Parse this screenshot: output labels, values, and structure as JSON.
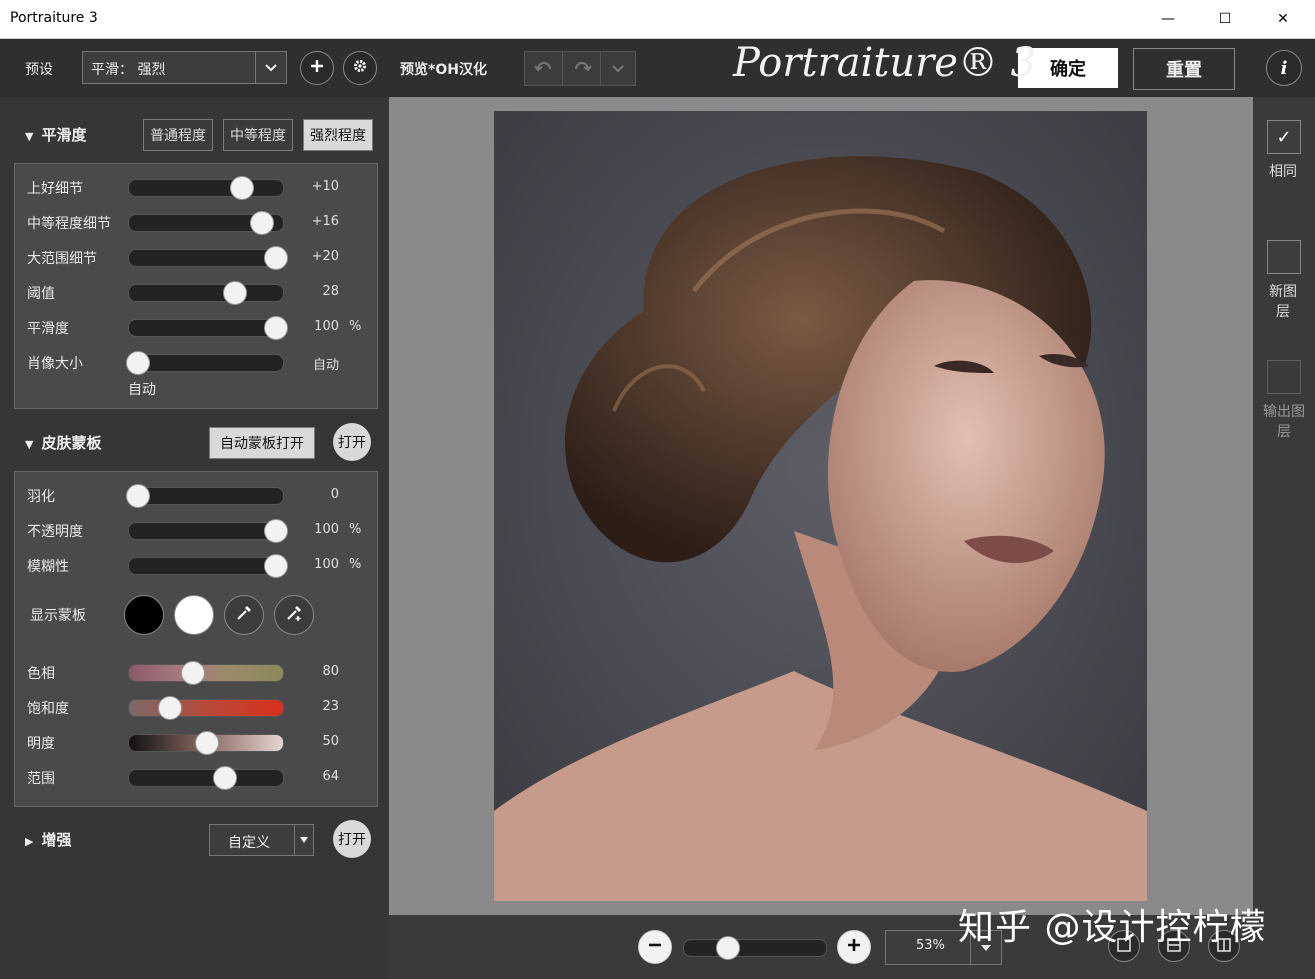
{
  "window": {
    "title": "Portraiture 3",
    "minimize": "—",
    "maximize": "☐",
    "close": "✕"
  },
  "toolbar": {
    "preset_label": "预设",
    "preset_value": "平滑： 强烈",
    "preview_label": "预览*OH汉化",
    "app_logo": "Portraiture® 3",
    "ok_label": "确定",
    "reset_label": "重置",
    "info_label": "i"
  },
  "smoothing": {
    "title": "平滑度",
    "levels": [
      "普通程度",
      "中等程度",
      "强烈程度"
    ],
    "active_level": 2,
    "sliders": [
      {
        "label": "上好细节",
        "value": "+10",
        "pos": 0.73
      },
      {
        "label": "中等程度细节",
        "value": "+16",
        "pos": 0.86
      },
      {
        "label": "大范围细节",
        "value": "+20",
        "pos": 0.95
      },
      {
        "label": "阈值",
        "value": "28",
        "pos": 0.68
      },
      {
        "label": "平滑度",
        "value": "100",
        "unit": "%",
        "pos": 0.95
      },
      {
        "label": "肖像大小",
        "value": "自动",
        "pos": 0.05
      }
    ],
    "portrait_size_sub": "自动"
  },
  "skin_mask": {
    "title": "皮肤蒙板",
    "auto_label": "自动蒙板打开",
    "toggle_label": "打开",
    "sliders": [
      {
        "label": "羽化",
        "value": "0",
        "pos": 0.05
      },
      {
        "label": "不透明度",
        "value": "100",
        "unit": "%",
        "pos": 0.95
      },
      {
        "label": "模糊性",
        "value": "100",
        "unit": "%",
        "pos": 0.95
      }
    ],
    "show_mask_label": "显示蒙板",
    "color_sliders": [
      {
        "label": "色相",
        "value": "80",
        "pos": 0.41
      },
      {
        "label": "饱和度",
        "value": "23",
        "pos": 0.26
      },
      {
        "label": "明度",
        "value": "50",
        "pos": 0.5
      },
      {
        "label": "范围",
        "value": "64",
        "pos": 0.62
      }
    ]
  },
  "enhance": {
    "title": "增强",
    "mode": "自定义",
    "toggle_label": "打开"
  },
  "right_panel": {
    "same_label": "相同",
    "new_layer_label": "新图层",
    "output_layer_label": "输出图层"
  },
  "zoom": {
    "value": "53%",
    "pos": 0.3
  },
  "watermark": "知乎 @设计控柠檬",
  "colors": {
    "accent_white": "#ffffff",
    "panel": "#363636",
    "group": "#4a4a4a",
    "active_btn": "#d9d9d9"
  }
}
